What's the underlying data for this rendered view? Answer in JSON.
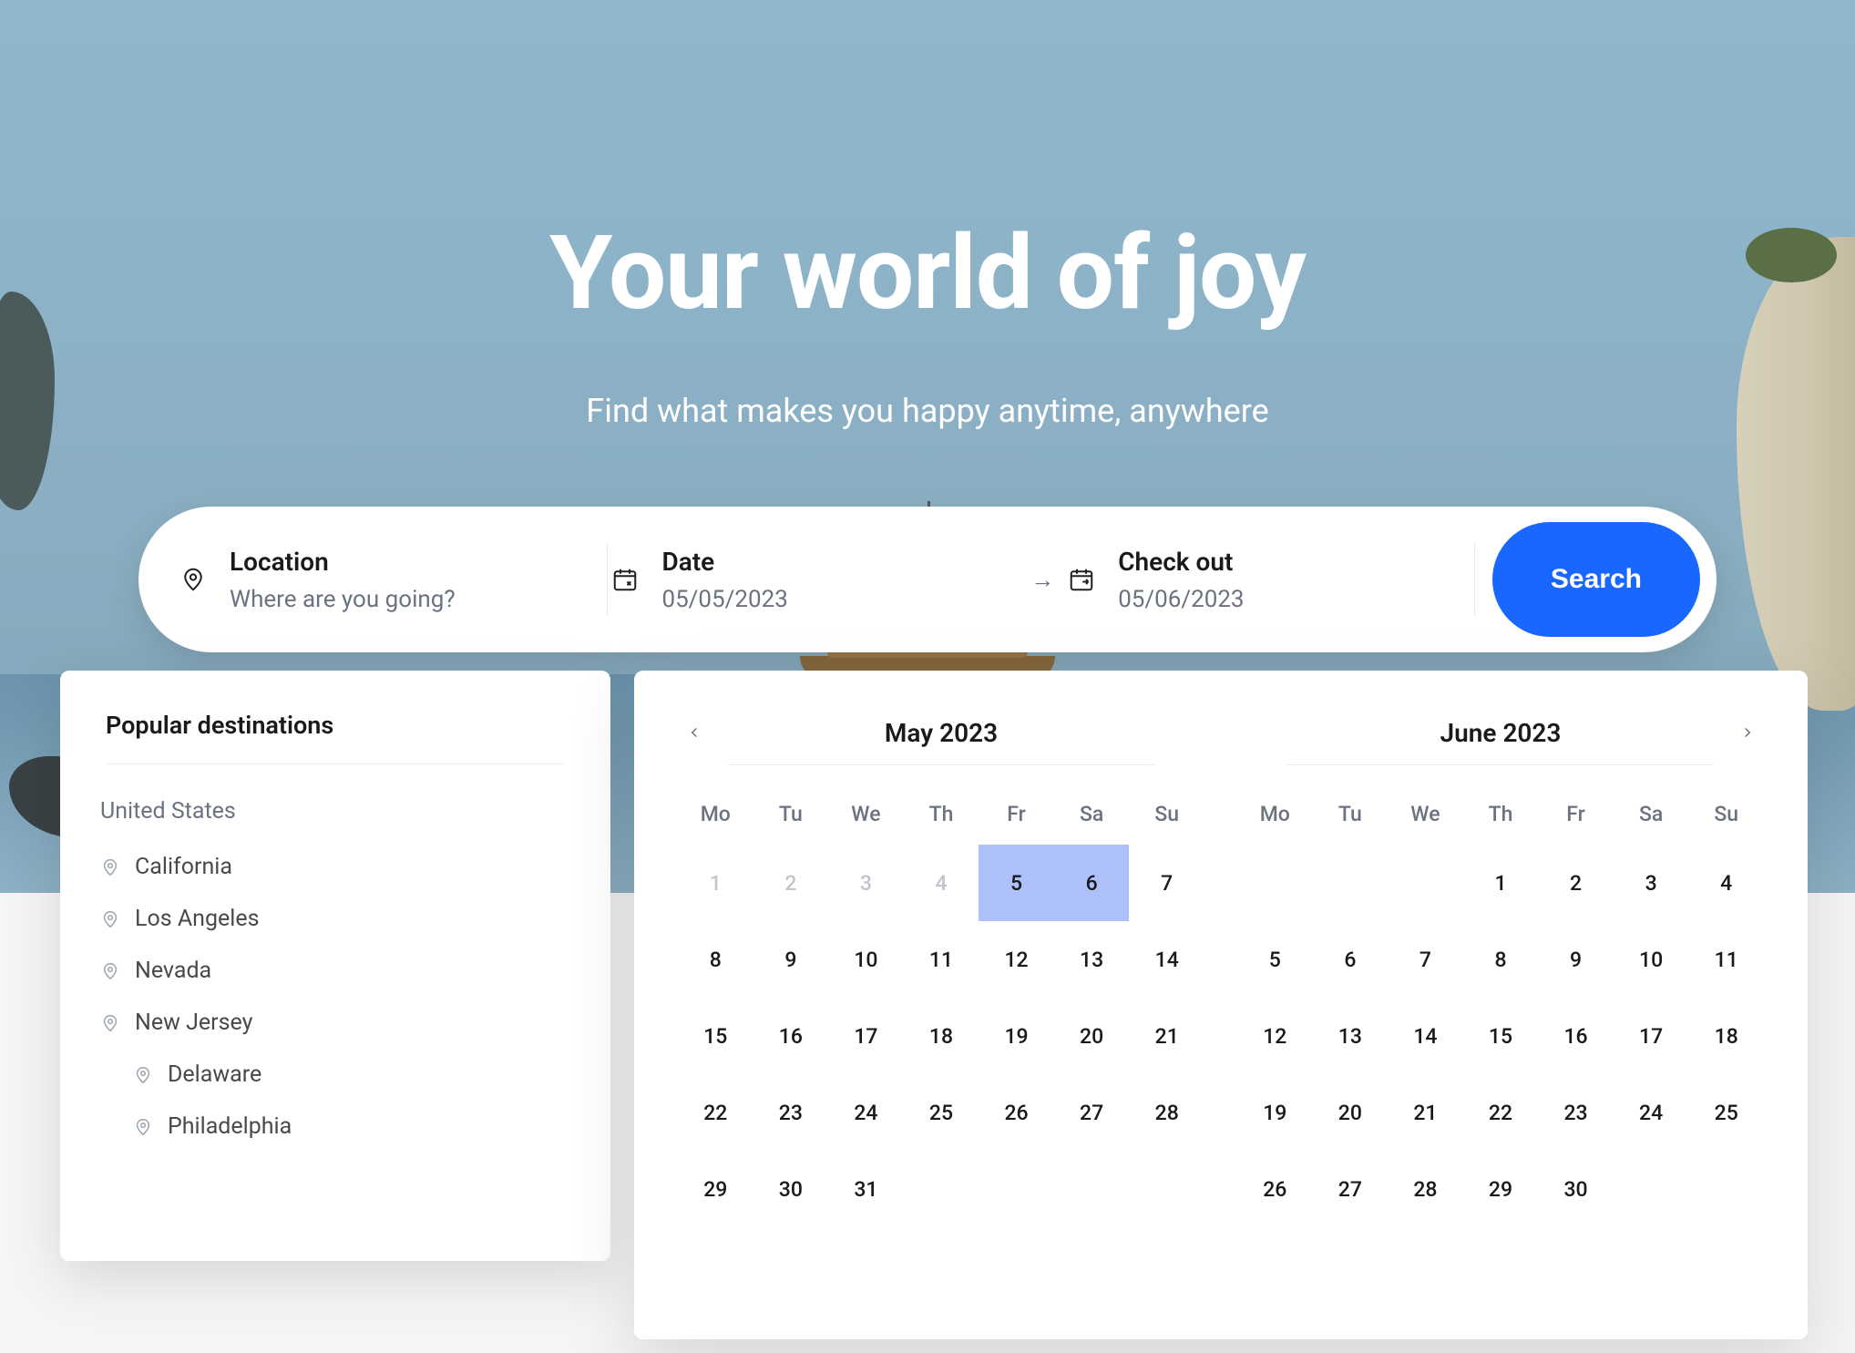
{
  "hero": {
    "title": "Your world of joy",
    "subtitle": "Find what makes you happy anytime, anywhere"
  },
  "search": {
    "location_label": "Location",
    "location_placeholder": "Where are you going?",
    "date_label": "Date",
    "date_value": "05/05/2023",
    "checkout_label": "Check out",
    "checkout_value": "05/06/2023",
    "button": "Search"
  },
  "popular": {
    "title": "Popular destinations",
    "groups": [
      {
        "label": "United States",
        "items": [
          {
            "name": "California",
            "sub": false
          },
          {
            "name": "Los Angeles",
            "sub": false
          },
          {
            "name": "Nevada",
            "sub": false
          },
          {
            "name": "New Jersey",
            "sub": false
          },
          {
            "name": "Delaware",
            "sub": true
          },
          {
            "name": "Philadelphia",
            "sub": true
          }
        ]
      }
    ]
  },
  "calendar": {
    "dow": [
      "Mo",
      "Tu",
      "We",
      "Th",
      "Fr",
      "Sa",
      "Su"
    ],
    "months": [
      {
        "title": "May 2023",
        "nav": "prev",
        "weeks": [
          [
            {
              "d": "1",
              "o": true
            },
            {
              "d": "2",
              "o": true
            },
            {
              "d": "3",
              "o": true
            },
            {
              "d": "4",
              "o": true
            },
            {
              "d": "5",
              "sel": true
            },
            {
              "d": "6",
              "sel": true
            },
            {
              "d": "7"
            }
          ],
          [
            {
              "d": "8"
            },
            {
              "d": "9"
            },
            {
              "d": "10"
            },
            {
              "d": "11"
            },
            {
              "d": "12"
            },
            {
              "d": "13"
            },
            {
              "d": "14"
            }
          ],
          [
            {
              "d": "15"
            },
            {
              "d": "16"
            },
            {
              "d": "17"
            },
            {
              "d": "18"
            },
            {
              "d": "19"
            },
            {
              "d": "20"
            },
            {
              "d": "21"
            }
          ],
          [
            {
              "d": "22"
            },
            {
              "d": "23"
            },
            {
              "d": "24"
            },
            {
              "d": "25"
            },
            {
              "d": "26"
            },
            {
              "d": "27"
            },
            {
              "d": "28"
            }
          ],
          [
            {
              "d": "29"
            },
            {
              "d": "30"
            },
            {
              "d": "31"
            },
            {
              "d": ""
            },
            {
              "d": ""
            },
            {
              "d": ""
            },
            {
              "d": ""
            }
          ]
        ]
      },
      {
        "title": "June 2023",
        "nav": "next",
        "weeks": [
          [
            {
              "d": ""
            },
            {
              "d": ""
            },
            {
              "d": ""
            },
            {
              "d": "1"
            },
            {
              "d": "2"
            },
            {
              "d": "3"
            },
            {
              "d": "4"
            }
          ],
          [
            {
              "d": "5"
            },
            {
              "d": "6"
            },
            {
              "d": "7"
            },
            {
              "d": "8"
            },
            {
              "d": "9"
            },
            {
              "d": "10"
            },
            {
              "d": "11"
            }
          ],
          [
            {
              "d": "12"
            },
            {
              "d": "13"
            },
            {
              "d": "14"
            },
            {
              "d": "15"
            },
            {
              "d": "16"
            },
            {
              "d": "17"
            },
            {
              "d": "18"
            }
          ],
          [
            {
              "d": "19"
            },
            {
              "d": "20"
            },
            {
              "d": "21"
            },
            {
              "d": "22"
            },
            {
              "d": "23"
            },
            {
              "d": "24"
            },
            {
              "d": "25"
            }
          ],
          [
            {
              "d": "26"
            },
            {
              "d": "27"
            },
            {
              "d": "28"
            },
            {
              "d": "29"
            },
            {
              "d": "30"
            },
            {
              "d": ""
            },
            {
              "d": ""
            }
          ]
        ]
      }
    ]
  }
}
